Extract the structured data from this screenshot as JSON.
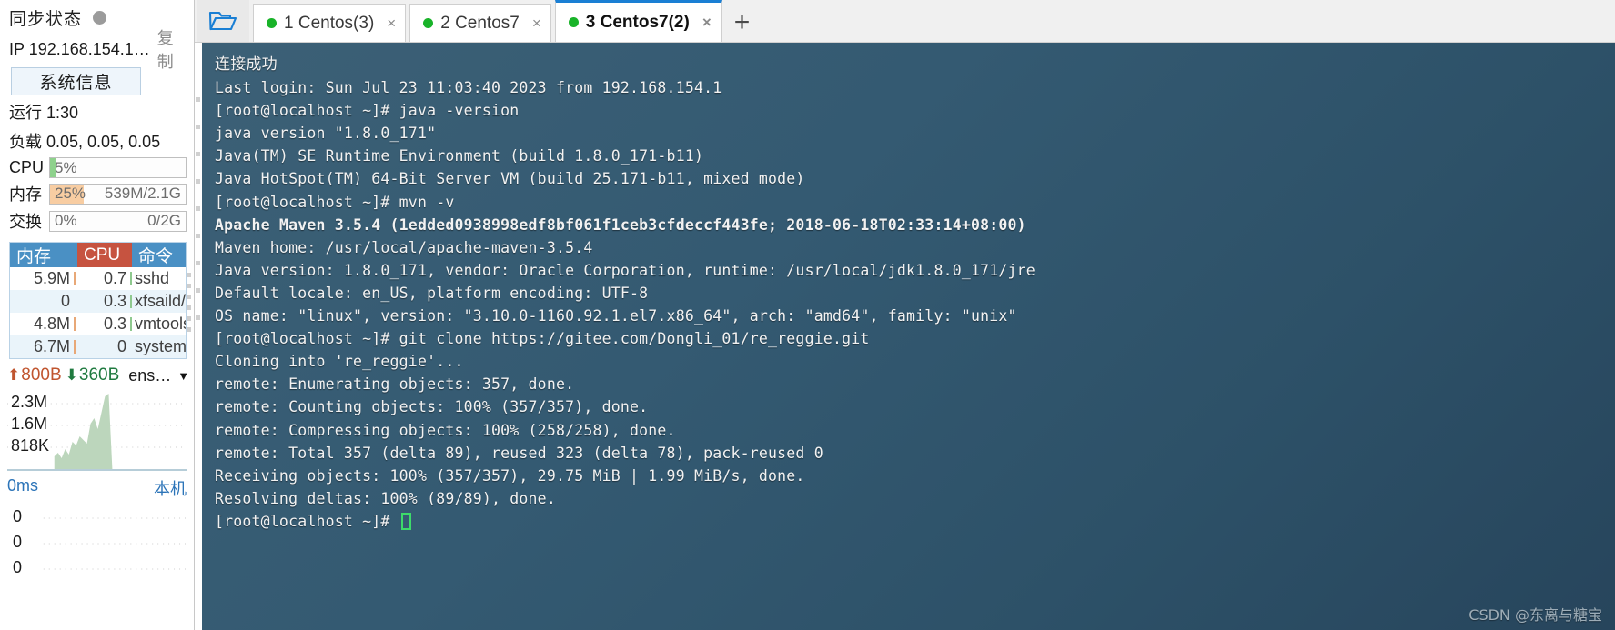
{
  "sidebar": {
    "sync": {
      "label": "同步状态",
      "status_color": "#9b9b9b"
    },
    "ip": {
      "text": "IP 192.168.154.1…",
      "copy_label": "复制"
    },
    "sysinfo_button": "系统信息",
    "uptime": "运行 1:30",
    "load": "负载 0.05, 0.05, 0.05",
    "meters": [
      {
        "name": "CPU",
        "percent": "5%",
        "right": "",
        "fill_pct": 5,
        "fill_color": "#8ed18c"
      },
      {
        "name": "内存",
        "percent": "25%",
        "right": "539M/2.1G",
        "fill_pct": 25,
        "fill_color": "#f8cda2"
      },
      {
        "name": "交换",
        "percent": "0%",
        "right": "0/2G",
        "fill_pct": 0,
        "fill_color": "#f8cda2"
      }
    ],
    "process_table": {
      "headers": {
        "mem": "内存",
        "cpu": "CPU",
        "cmd": "命令"
      },
      "header_colors": {
        "mem": "#4a90c4",
        "cpu": "#c65340",
        "cmd": "#4a90c4"
      },
      "rows": [
        {
          "mem": "5.9M",
          "cpu": "0.7",
          "cmd": "sshd"
        },
        {
          "mem": "0",
          "cpu": "0.3",
          "cmd": "xfsaild/d"
        },
        {
          "mem": "4.8M",
          "cpu": "0.3",
          "cmd": "vmtoolsd"
        },
        {
          "mem": "6.7M",
          "cpu": "0",
          "cmd": "systemd"
        }
      ]
    },
    "network": {
      "up_value": "800B",
      "down_value": "360B",
      "interface": "ens…",
      "up_color": "#c0552f",
      "down_color": "#1f7a3f",
      "graph_labels": [
        "2.3M",
        "1.6M",
        "818K"
      ],
      "graph_color": "#bcd6bc"
    },
    "latency": {
      "value": "0ms",
      "target": "本机",
      "labels": [
        "0",
        "0",
        "0"
      ],
      "text_color": "#2c74b8"
    }
  },
  "toolbar": {
    "folder_icon": "open-folder-icon",
    "add_tab_label": "+"
  },
  "tabs": [
    {
      "label": "1 Centos(3)",
      "dot_color": "#19b329",
      "close": "×",
      "active": false
    },
    {
      "label": "2 Centos7",
      "dot_color": "#19b329",
      "close": "×",
      "active": false
    },
    {
      "label": "3 Centos7(2)",
      "dot_color": "#19b329",
      "close": "×",
      "active": true
    }
  ],
  "terminal": {
    "lines": [
      {
        "text": "连接成功",
        "cjk": true,
        "bold": false
      },
      {
        "text": "Last login: Sun Jul 23 11:03:40 2023 from 192.168.154.1",
        "cjk": false,
        "bold": false
      },
      {
        "text": "[root@localhost ~]# java -version",
        "cjk": false,
        "bold": false
      },
      {
        "text": "java version \"1.8.0_171\"",
        "cjk": false,
        "bold": false
      },
      {
        "text": "Java(TM) SE Runtime Environment (build 1.8.0_171-b11)",
        "cjk": false,
        "bold": false
      },
      {
        "text": "Java HotSpot(TM) 64-Bit Server VM (build 25.171-b11, mixed mode)",
        "cjk": false,
        "bold": false
      },
      {
        "text": "[root@localhost ~]# mvn -v",
        "cjk": false,
        "bold": false
      },
      {
        "text": "Apache Maven 3.5.4 (1edded0938998edf8bf061f1ceb3cfdeccf443fe; 2018-06-18T02:33:14+08:00)",
        "cjk": false,
        "bold": true
      },
      {
        "text": "Maven home: /usr/local/apache-maven-3.5.4",
        "cjk": false,
        "bold": false
      },
      {
        "text": "Java version: 1.8.0_171, vendor: Oracle Corporation, runtime: /usr/local/jdk1.8.0_171/jre",
        "cjk": false,
        "bold": false
      },
      {
        "text": "Default locale: en_US, platform encoding: UTF-8",
        "cjk": false,
        "bold": false
      },
      {
        "text": "OS name: \"linux\", version: \"3.10.0-1160.92.1.el7.x86_64\", arch: \"amd64\", family: \"unix\"",
        "cjk": false,
        "bold": false
      },
      {
        "text": "[root@localhost ~]# git clone https://gitee.com/Dongli_01/re_reggie.git",
        "cjk": false,
        "bold": false
      },
      {
        "text": "Cloning into 're_reggie'...",
        "cjk": false,
        "bold": false
      },
      {
        "text": "remote: Enumerating objects: 357, done.",
        "cjk": false,
        "bold": false
      },
      {
        "text": "remote: Counting objects: 100% (357/357), done.",
        "cjk": false,
        "bold": false
      },
      {
        "text": "remote: Compressing objects: 100% (258/258), done.",
        "cjk": false,
        "bold": false
      },
      {
        "text": "remote: Total 357 (delta 89), reused 323 (delta 78), pack-reused 0",
        "cjk": false,
        "bold": false
      },
      {
        "text": "Receiving objects: 100% (357/357), 29.75 MiB | 1.99 MiB/s, done.",
        "cjk": false,
        "bold": false
      },
      {
        "text": "Resolving deltas: 100% (89/89), done.",
        "cjk": false,
        "bold": false
      }
    ],
    "prompt": "[root@localhost ~]# ",
    "cursor_color": "#3ddb6a",
    "background_color": "#2d5168"
  },
  "watermark": "CSDN @东离与糖宝"
}
